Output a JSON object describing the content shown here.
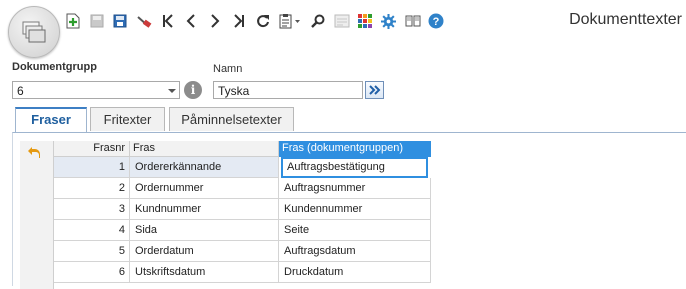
{
  "window": {
    "title": "Dokumenttexter"
  },
  "toolbar": {
    "buttons": [
      {
        "icon": "new-record-icon",
        "color": "#2e9d2e"
      },
      {
        "icon": "save-icon-disabled",
        "color": "#b0b0b0"
      },
      {
        "icon": "save-icon",
        "color": "#2f6db5"
      },
      {
        "icon": "delete-icon",
        "color": "#cc3b3b"
      },
      {
        "icon": "first-record-icon"
      },
      {
        "icon": "previous-record-icon"
      },
      {
        "icon": "next-record-icon"
      },
      {
        "icon": "last-record-icon"
      },
      {
        "icon": "refresh-icon"
      },
      {
        "icon": "clipboard-dropdown-icon"
      },
      {
        "icon": "search-icon"
      },
      {
        "icon": "form-icon-disabled"
      },
      {
        "icon": "apps-grid-icon"
      },
      {
        "icon": "settings-gear-icon",
        "color": "#2f82c9"
      },
      {
        "icon": "book-icon"
      },
      {
        "icon": "help-icon",
        "color": "#2f82c9"
      }
    ]
  },
  "filters": {
    "dokumentgrupp": {
      "label": "Dokumentgrupp",
      "value": "6"
    },
    "namn": {
      "label": "Namn",
      "value": "Tyska"
    }
  },
  "tabs": [
    {
      "label": "Fraser",
      "active": true
    },
    {
      "label": "Fritexter",
      "active": false
    },
    {
      "label": "Påminnelsetexter",
      "active": false
    }
  ],
  "grid": {
    "columns": {
      "fras_nr": "Frasnr",
      "fras": "Fras",
      "fras_dok": "Fras (dokumentgruppen)"
    },
    "rows": [
      {
        "nr": "1",
        "fras": "Ordererkännande",
        "fras_dok": "Auftragsbestätigung"
      },
      {
        "nr": "2",
        "fras": "Ordernummer",
        "fras_dok": "Auftragsnummer"
      },
      {
        "nr": "3",
        "fras": "Kundnummer",
        "fras_dok": "Kundennummer"
      },
      {
        "nr": "4",
        "fras": "Sida",
        "fras_dok": "Seite"
      },
      {
        "nr": "5",
        "fras": "Orderdatum",
        "fras_dok": "Auftragsdatum"
      },
      {
        "nr": "6",
        "fras": "Utskriftsdatum",
        "fras_dok": "Druckdatum"
      }
    ]
  },
  "colors": {
    "accent": "#2f8fe0",
    "tab_active_text": "#1f5f9f",
    "current_row": "#e4eaf3"
  }
}
